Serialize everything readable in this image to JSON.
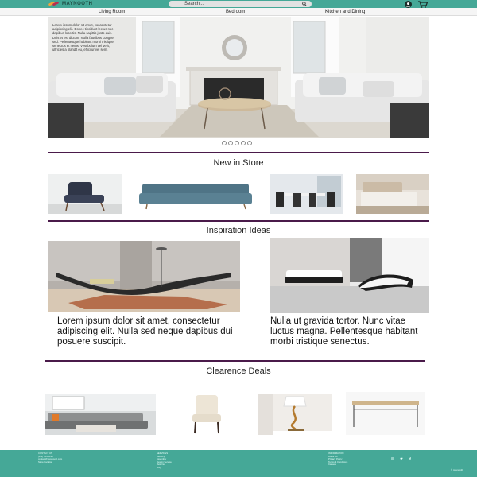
{
  "brand": {
    "name": "MAYNOOTH"
  },
  "search": {
    "placeholder": "Search..."
  },
  "nav": {
    "items": [
      "Living Room",
      "Bedroom",
      "Kitchen and Dining"
    ]
  },
  "hero": {
    "overlay_text": "Lorem ipsum dolor sit amet, consectetur adipiscing elit. Donec tincidunt lectus nec dapibus lobortis. Nulla sagittis justo quis. Duis et est dictum. Nulla faucibus congue sed. Pellentesque habitant morbi tristique senectus et netus. Vestibulum vel velit, ultricies a blandit eu, efficitur vel sem."
  },
  "sections": {
    "new_in_store": "New in Store",
    "inspiration": "Inspiration Ideas",
    "clearance": "Clearence Deals"
  },
  "inspiration": {
    "left_text": "Lorem ipsum dolor sit amet, consectetur adipiscing elit. Nulla sed neque dapibus dui posuere suscipit.",
    "right_text": "Nulla ut gravida tortor. Nunc vitae luctus magna. Pellentesque habitant morbi tristique senectus."
  },
  "footer": {
    "col1": [
      "CONTACT US",
      "(111) 555-0123",
      "contact@maynooth.com",
      "Store Location"
    ],
    "col2": [
      "SERVICES",
      "Delivery",
      "Assembly",
      "Design Service",
      "Returns",
      "FAQ"
    ],
    "col3": [
      "INFORMATION",
      "About Us",
      "Privacy Policy",
      "Terms & Conditions",
      "Careers"
    ],
    "copyright": "© maynooth"
  },
  "colors": {
    "brand_teal": "#45a897",
    "rule_purple": "#4a1a4a"
  }
}
